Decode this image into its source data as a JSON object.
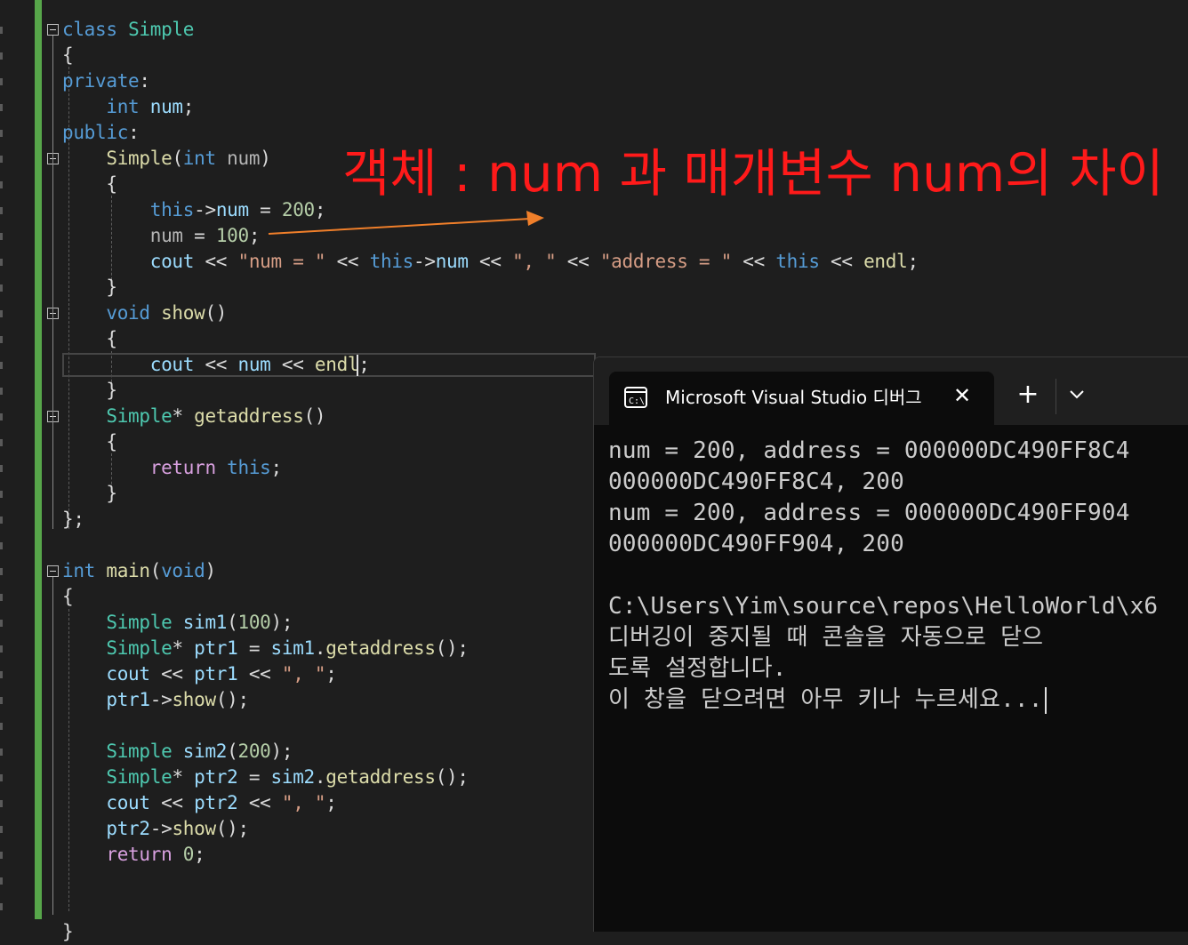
{
  "code_lines": [
    [
      {
        "t": "class",
        "c": "kw"
      },
      {
        "t": " "
      },
      {
        "t": "Simple",
        "c": "cls"
      }
    ],
    [
      {
        "t": "{"
      }
    ],
    [
      {
        "t": "private",
        "c": "kw"
      },
      {
        "t": ":"
      }
    ],
    [
      {
        "t": "    "
      },
      {
        "t": "int",
        "c": "kw"
      },
      {
        "t": " "
      },
      {
        "t": "num",
        "c": "var"
      },
      {
        "t": ";"
      }
    ],
    [
      {
        "t": "public",
        "c": "kw"
      },
      {
        "t": ":"
      }
    ],
    [
      {
        "t": "    "
      },
      {
        "t": "Simple",
        "c": "fn"
      },
      {
        "t": "("
      },
      {
        "t": "int",
        "c": "kw"
      },
      {
        "t": " "
      },
      {
        "t": "num",
        "c": "op"
      },
      {
        "t": ")"
      }
    ],
    [
      {
        "t": "    {"
      }
    ],
    [
      {
        "t": "        "
      },
      {
        "t": "this",
        "c": "kw"
      },
      {
        "t": "->"
      },
      {
        "t": "num",
        "c": "var"
      },
      {
        "t": " = "
      },
      {
        "t": "200",
        "c": "num"
      },
      {
        "t": ";"
      }
    ],
    [
      {
        "t": "        "
      },
      {
        "t": "num",
        "c": "op"
      },
      {
        "t": " = "
      },
      {
        "t": "100",
        "c": "num"
      },
      {
        "t": ";"
      }
    ],
    [
      {
        "t": "        "
      },
      {
        "t": "cout",
        "c": "var"
      },
      {
        "t": " << "
      },
      {
        "t": "\"num = \"",
        "c": "str"
      },
      {
        "t": " << "
      },
      {
        "t": "this",
        "c": "kw"
      },
      {
        "t": "->"
      },
      {
        "t": "num",
        "c": "var"
      },
      {
        "t": " << "
      },
      {
        "t": "\", \"",
        "c": "str"
      },
      {
        "t": " << "
      },
      {
        "t": "\"address = \"",
        "c": "str"
      },
      {
        "t": " << "
      },
      {
        "t": "this",
        "c": "kw"
      },
      {
        "t": " << "
      },
      {
        "t": "endl",
        "c": "fn"
      },
      {
        "t": ";"
      }
    ],
    [
      {
        "t": "    }"
      }
    ],
    [
      {
        "t": "    "
      },
      {
        "t": "void",
        "c": "kw"
      },
      {
        "t": " "
      },
      {
        "t": "show",
        "c": "fn"
      },
      {
        "t": "()"
      }
    ],
    [
      {
        "t": "    {"
      }
    ],
    [
      {
        "t": "        "
      },
      {
        "t": "cout",
        "c": "var"
      },
      {
        "t": " << "
      },
      {
        "t": "num",
        "c": "var"
      },
      {
        "t": " << "
      },
      {
        "t": "endl",
        "c": "fn"
      },
      {
        "t": ";"
      }
    ],
    [
      {
        "t": "    }"
      }
    ],
    [
      {
        "t": "    "
      },
      {
        "t": "Simple",
        "c": "cls"
      },
      {
        "t": "* "
      },
      {
        "t": "getaddress",
        "c": "fn"
      },
      {
        "t": "()"
      }
    ],
    [
      {
        "t": "    {"
      }
    ],
    [
      {
        "t": "        "
      },
      {
        "t": "return",
        "c": "ctrl"
      },
      {
        "t": " "
      },
      {
        "t": "this",
        "c": "kw"
      },
      {
        "t": ";"
      }
    ],
    [
      {
        "t": "    }"
      }
    ],
    [
      {
        "t": "};"
      }
    ],
    [],
    [
      {
        "t": "int",
        "c": "kw"
      },
      {
        "t": " "
      },
      {
        "t": "main",
        "c": "fn"
      },
      {
        "t": "("
      },
      {
        "t": "void",
        "c": "kw"
      },
      {
        "t": ")"
      }
    ],
    [
      {
        "t": "{"
      }
    ],
    [
      {
        "t": "    "
      },
      {
        "t": "Simple",
        "c": "cls"
      },
      {
        "t": " "
      },
      {
        "t": "sim1",
        "c": "var"
      },
      {
        "t": "("
      },
      {
        "t": "100",
        "c": "num"
      },
      {
        "t": ");"
      }
    ],
    [
      {
        "t": "    "
      },
      {
        "t": "Simple",
        "c": "cls"
      },
      {
        "t": "* "
      },
      {
        "t": "ptr1",
        "c": "var"
      },
      {
        "t": " = "
      },
      {
        "t": "sim1",
        "c": "var"
      },
      {
        "t": "."
      },
      {
        "t": "getaddress",
        "c": "fn"
      },
      {
        "t": "();"
      }
    ],
    [
      {
        "t": "    "
      },
      {
        "t": "cout",
        "c": "var"
      },
      {
        "t": " << "
      },
      {
        "t": "ptr1",
        "c": "var"
      },
      {
        "t": " << "
      },
      {
        "t": "\", \"",
        "c": "str"
      },
      {
        "t": ";"
      }
    ],
    [
      {
        "t": "    "
      },
      {
        "t": "ptr1",
        "c": "var"
      },
      {
        "t": "->"
      },
      {
        "t": "show",
        "c": "fn"
      },
      {
        "t": "();"
      }
    ],
    [],
    [
      {
        "t": "    "
      },
      {
        "t": "Simple",
        "c": "cls"
      },
      {
        "t": " "
      },
      {
        "t": "sim2",
        "c": "var"
      },
      {
        "t": "("
      },
      {
        "t": "200",
        "c": "num"
      },
      {
        "t": ");"
      }
    ],
    [
      {
        "t": "    "
      },
      {
        "t": "Simple",
        "c": "cls"
      },
      {
        "t": "* "
      },
      {
        "t": "ptr2",
        "c": "var"
      },
      {
        "t": " = "
      },
      {
        "t": "sim2",
        "c": "var"
      },
      {
        "t": "."
      },
      {
        "t": "getaddress",
        "c": "fn"
      },
      {
        "t": "();"
      }
    ],
    [
      {
        "t": "    "
      },
      {
        "t": "cout",
        "c": "var"
      },
      {
        "t": " << "
      },
      {
        "t": "ptr2",
        "c": "var"
      },
      {
        "t": " << "
      },
      {
        "t": "\", \"",
        "c": "str"
      },
      {
        "t": ";"
      }
    ],
    [
      {
        "t": "    "
      },
      {
        "t": "ptr2",
        "c": "var"
      },
      {
        "t": "->"
      },
      {
        "t": "show",
        "c": "fn"
      },
      {
        "t": "();"
      }
    ],
    [
      {
        "t": "    "
      },
      {
        "t": "return",
        "c": "ctrl"
      },
      {
        "t": " "
      },
      {
        "t": "0",
        "c": "num"
      },
      {
        "t": ";"
      }
    ],
    [],
    [],
    [
      {
        "t": "}"
      }
    ]
  ],
  "annotation": {
    "text": "객체 : num 과 매개변수 num의 차이",
    "color": "#ff1a1a",
    "arrow_color": "#f07f2a"
  },
  "terminal": {
    "tab_title": "Microsoft Visual Studio 디버그",
    "tab_icon": "terminal-icon",
    "close_symbol": "✕",
    "new_tab_symbol": "+",
    "dropdown_icon": "chevron-down-icon",
    "output_lines": [
      "num = 200, address = 000000DC490FF8C4",
      "000000DC490FF8C4, 200",
      "num = 200, address = 000000DC490FF904",
      "000000DC490FF904, 200",
      "",
      "C:\\Users\\Yim\\source\\repos\\HelloWorld\\x6",
      "디버깅이 중지될 때 콘솔을 자동으로 닫으",
      "도록 설정합니다.",
      "이 창을 닫으려면 아무 키나 누르세요..."
    ]
  },
  "colors": {
    "editor_bg": "#1e1e1e",
    "keyword": "#569cd6",
    "type": "#4ec9b0",
    "function": "#dcdcaa",
    "variable": "#9cdcfe",
    "string": "#d69d85",
    "number": "#b5cea8",
    "change_bar": "#57a64a",
    "terminal_bg": "#0c0c0c"
  }
}
